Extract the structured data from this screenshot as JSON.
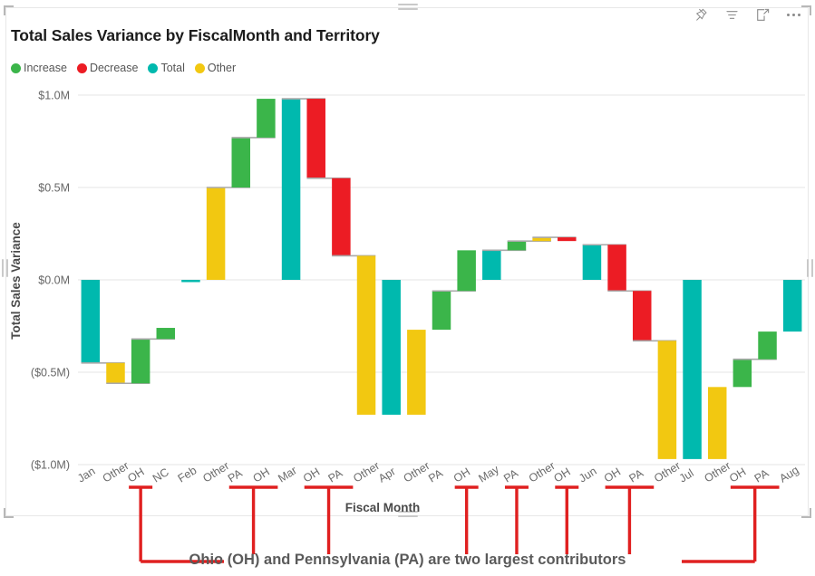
{
  "header": {
    "title": "Total Sales Variance by FiscalMonth and Territory",
    "icons": [
      {
        "name": "pin-icon",
        "label": "Pin visual"
      },
      {
        "name": "filter-icon",
        "label": "Filters"
      },
      {
        "name": "focus-mode-icon",
        "label": "Focus mode"
      },
      {
        "name": "more-options-icon",
        "label": "More options"
      }
    ]
  },
  "legend": {
    "items": [
      {
        "label": "Increase",
        "color": "#3BB54A"
      },
      {
        "label": "Decrease",
        "color": "#EC1C24"
      },
      {
        "label": "Total",
        "color": "#00B9AE"
      },
      {
        "label": "Other",
        "color": "#F2C811"
      }
    ]
  },
  "annotation": {
    "text": "Ohio (OH) and Pennsylvania (PA) are two largest contributors",
    "color": "#E02020",
    "bracket_label_indices": [
      2,
      6,
      7,
      9,
      10,
      15,
      17,
      19,
      21,
      22,
      26,
      27
    ]
  },
  "chart_data": {
    "type": "bar",
    "subtype": "waterfall",
    "title": "Total Sales Variance by FiscalMonth and Territory",
    "xlabel": "Fiscal Month",
    "ylabel": "Total Sales Variance",
    "ylim": [
      -1.0,
      1.0
    ],
    "y_ticks": [
      1.0,
      0.5,
      0.0,
      -0.5,
      -1.0
    ],
    "y_tick_labels": [
      "$1.0M",
      "$0.5M",
      "$0.0M",
      "($0.5M)",
      "($1.0M)"
    ],
    "units": "millions USD",
    "grid": true,
    "legend_position": "top-left",
    "categories": [
      "Jan",
      "Other",
      "OH",
      "NC",
      "Feb",
      "Other",
      "PA",
      "OH",
      "Mar",
      "OH",
      "PA",
      "Other",
      "Apr",
      "Other",
      "PA",
      "OH",
      "May",
      "PA",
      "Other",
      "OH",
      "Jun",
      "OH",
      "PA",
      "Other",
      "Jul",
      "Other",
      "OH",
      "PA",
      "Aug"
    ],
    "series": [
      {
        "name": "Total Sales Variance",
        "bars": [
          {
            "category": "Jan",
            "kind": "Total",
            "start": 0.0,
            "end": -0.45,
            "delta": -0.45
          },
          {
            "category": "Other",
            "kind": "Other",
            "start": -0.45,
            "end": -0.56,
            "delta": -0.11
          },
          {
            "category": "OH",
            "kind": "Increase",
            "start": -0.56,
            "end": -0.32,
            "delta": 0.24
          },
          {
            "category": "NC",
            "kind": "Increase",
            "start": -0.32,
            "end": -0.26,
            "delta": 0.06
          },
          {
            "category": "Feb",
            "kind": "Total",
            "start": 0.0,
            "end": -0.01,
            "delta": -0.01
          },
          {
            "category": "Other",
            "kind": "Other",
            "start": 0.0,
            "end": 0.5,
            "delta": 0.5
          },
          {
            "category": "PA",
            "kind": "Increase",
            "start": 0.5,
            "end": 0.77,
            "delta": 0.27
          },
          {
            "category": "OH",
            "kind": "Increase",
            "start": 0.77,
            "end": 0.98,
            "delta": 0.21
          },
          {
            "category": "Mar",
            "kind": "Total",
            "start": 0.0,
            "end": 0.98,
            "delta": 0.98
          },
          {
            "category": "OH",
            "kind": "Decrease",
            "start": 0.98,
            "end": 0.55,
            "delta": -0.43
          },
          {
            "category": "PA",
            "kind": "Decrease",
            "start": 0.55,
            "end": 0.13,
            "delta": -0.42
          },
          {
            "category": "Other",
            "kind": "Other",
            "start": 0.13,
            "end": -0.73,
            "delta": -0.86
          },
          {
            "category": "Apr",
            "kind": "Total",
            "start": 0.0,
            "end": -0.73,
            "delta": -0.73
          },
          {
            "category": "Other",
            "kind": "Other",
            "start": -0.27,
            "end": -0.73,
            "delta": -0.46
          },
          {
            "category": "PA",
            "kind": "Increase",
            "start": -0.27,
            "end": -0.06,
            "delta": 0.21
          },
          {
            "category": "OH",
            "kind": "Increase",
            "start": -0.06,
            "end": 0.16,
            "delta": 0.22
          },
          {
            "category": "May",
            "kind": "Total",
            "start": 0.0,
            "end": 0.16,
            "delta": 0.16
          },
          {
            "category": "PA",
            "kind": "Increase",
            "start": 0.16,
            "end": 0.21,
            "delta": 0.05
          },
          {
            "category": "Other",
            "kind": "Other",
            "start": 0.21,
            "end": 0.23,
            "delta": 0.02
          },
          {
            "category": "OH",
            "kind": "Decrease",
            "start": 0.23,
            "end": 0.21,
            "delta": -0.02
          },
          {
            "category": "Jun",
            "kind": "Total",
            "start": 0.0,
            "end": 0.19,
            "delta": 0.19
          },
          {
            "category": "OH",
            "kind": "Decrease",
            "start": 0.19,
            "end": -0.06,
            "delta": -0.25
          },
          {
            "category": "PA",
            "kind": "Decrease",
            "start": -0.06,
            "end": -0.33,
            "delta": -0.27
          },
          {
            "category": "Other",
            "kind": "Other",
            "start": -0.33,
            "end": -0.97,
            "delta": -0.64
          },
          {
            "category": "Jul",
            "kind": "Total",
            "start": 0.0,
            "end": -0.97,
            "delta": -0.97
          },
          {
            "category": "Other",
            "kind": "Other",
            "start": -0.58,
            "end": -0.97,
            "delta": -0.39
          },
          {
            "category": "OH",
            "kind": "Increase",
            "start": -0.58,
            "end": -0.43,
            "delta": 0.15
          },
          {
            "category": "PA",
            "kind": "Increase",
            "start": -0.43,
            "end": -0.28,
            "delta": 0.15
          },
          {
            "category": "Aug",
            "kind": "Total",
            "start": 0.0,
            "end": -0.28,
            "delta": -0.28
          }
        ]
      }
    ],
    "colors": {
      "Increase": "#3BB54A",
      "Decrease": "#EC1C24",
      "Total": "#00B9AE",
      "Other": "#F2C811"
    }
  }
}
